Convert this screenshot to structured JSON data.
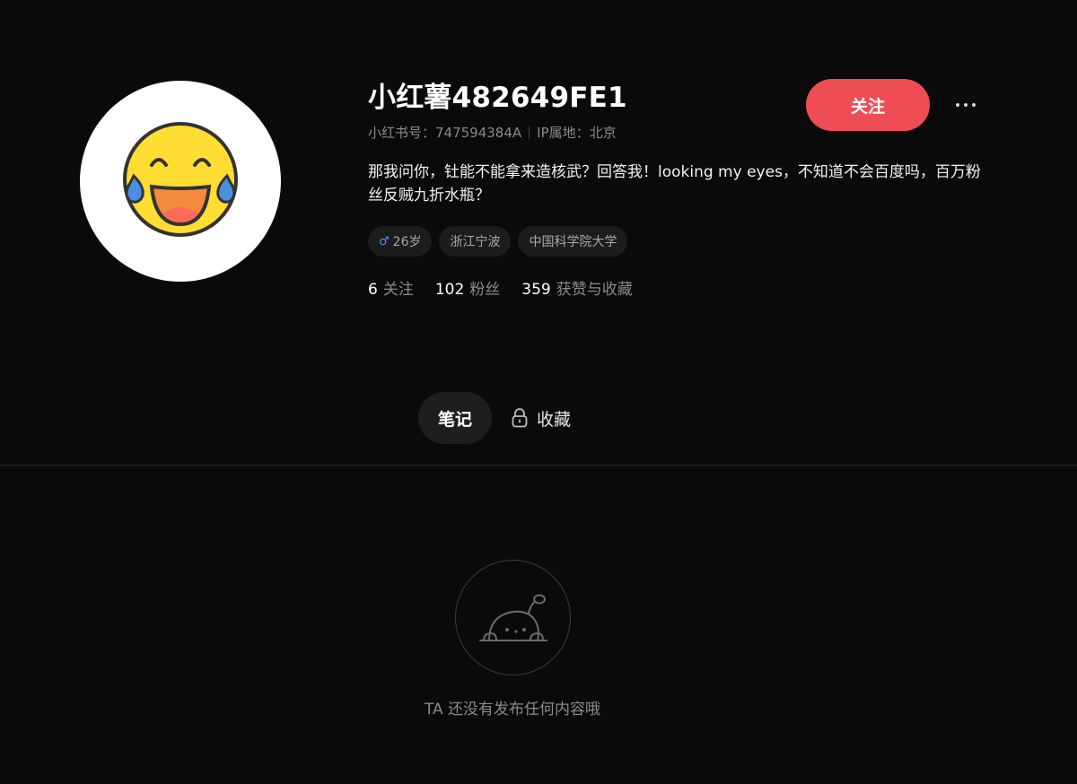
{
  "profile": {
    "username": "小红薯482649FE1",
    "id_label": "小红书号：747594384A",
    "ip_label": "IP属地：北京",
    "bio": "那我问你，钍能不能拿来造核武？回答我！looking my eyes，不知道不会百度吗，百万粉丝反贼九折水瓶？",
    "avatar_icon": "laughing-crying-emoji-icon",
    "tags": [
      {
        "icon": "male-gender-icon",
        "label": "26岁"
      },
      {
        "label": "浙江宁波"
      },
      {
        "label": "中国科学院大学"
      }
    ],
    "stats": [
      {
        "value": "6",
        "label": "关注"
      },
      {
        "value": "102",
        "label": "粉丝"
      },
      {
        "value": "359",
        "label": "获赞与收藏"
      }
    ]
  },
  "actions": {
    "follow_label": "关注",
    "more_icon": "more-dots-icon"
  },
  "tabs": [
    {
      "label": "笔记",
      "active": true
    },
    {
      "label": "收藏",
      "icon": "lock-icon",
      "active": false
    }
  ],
  "empty_state": {
    "icon": "peeking-creature-icon",
    "text": "TA 还没有发布任何内容哦"
  },
  "colors": {
    "background": "#0a0a0a",
    "accent": "#ee4d55",
    "muted_text": "#8a8a8a"
  }
}
